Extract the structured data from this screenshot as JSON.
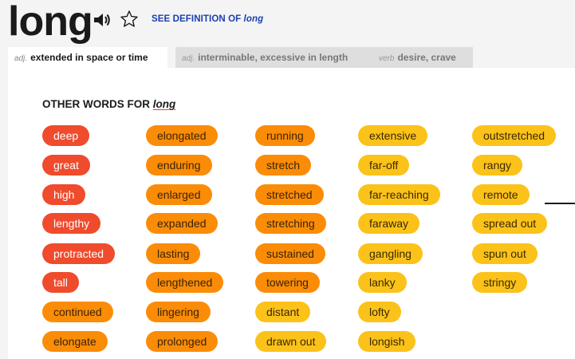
{
  "header": {
    "word": "long",
    "see_definition_prefix": "SEE DEFINITION OF ",
    "see_definition_word": "long",
    "icons": {
      "speaker": "speaker-icon",
      "favorite": "star-outline-icon"
    }
  },
  "tabs": [
    {
      "pos": "adj.",
      "label": "extended in space or time",
      "active": true
    },
    {
      "pos": "adj.",
      "label": "interminable, excessive in length",
      "active": false
    },
    {
      "pos": "verb",
      "label": "desire, crave",
      "active": false
    }
  ],
  "section": {
    "title_prefix": "OTHER WORDS FOR ",
    "title_word": "long"
  },
  "colors": {
    "red": "#ef4b2c",
    "orange": "#fb8c08",
    "amber": "#fba80c",
    "yellow": "#fbc21a",
    "link": "#1a3fb0"
  },
  "synonyms": {
    "column1": [
      "deep",
      "great",
      "high",
      "lengthy",
      "protracted",
      "tall",
      "continued",
      "elongate"
    ],
    "column2": [
      "elongated",
      "enduring",
      "enlarged",
      "expanded",
      "lasting",
      "lengthened",
      "lingering",
      "prolonged"
    ],
    "column3": [
      "running",
      "stretch",
      "stretched",
      "stretching",
      "sustained",
      "towering",
      "distant",
      "drawn out"
    ],
    "column4": [
      "extensive",
      "far-off",
      "far-reaching",
      "faraway",
      "gangling",
      "lanky",
      "lofty",
      "longish"
    ],
    "column5": [
      "outstretched",
      "rangy",
      "remote",
      "spread out",
      "spun out",
      "stringy"
    ]
  }
}
